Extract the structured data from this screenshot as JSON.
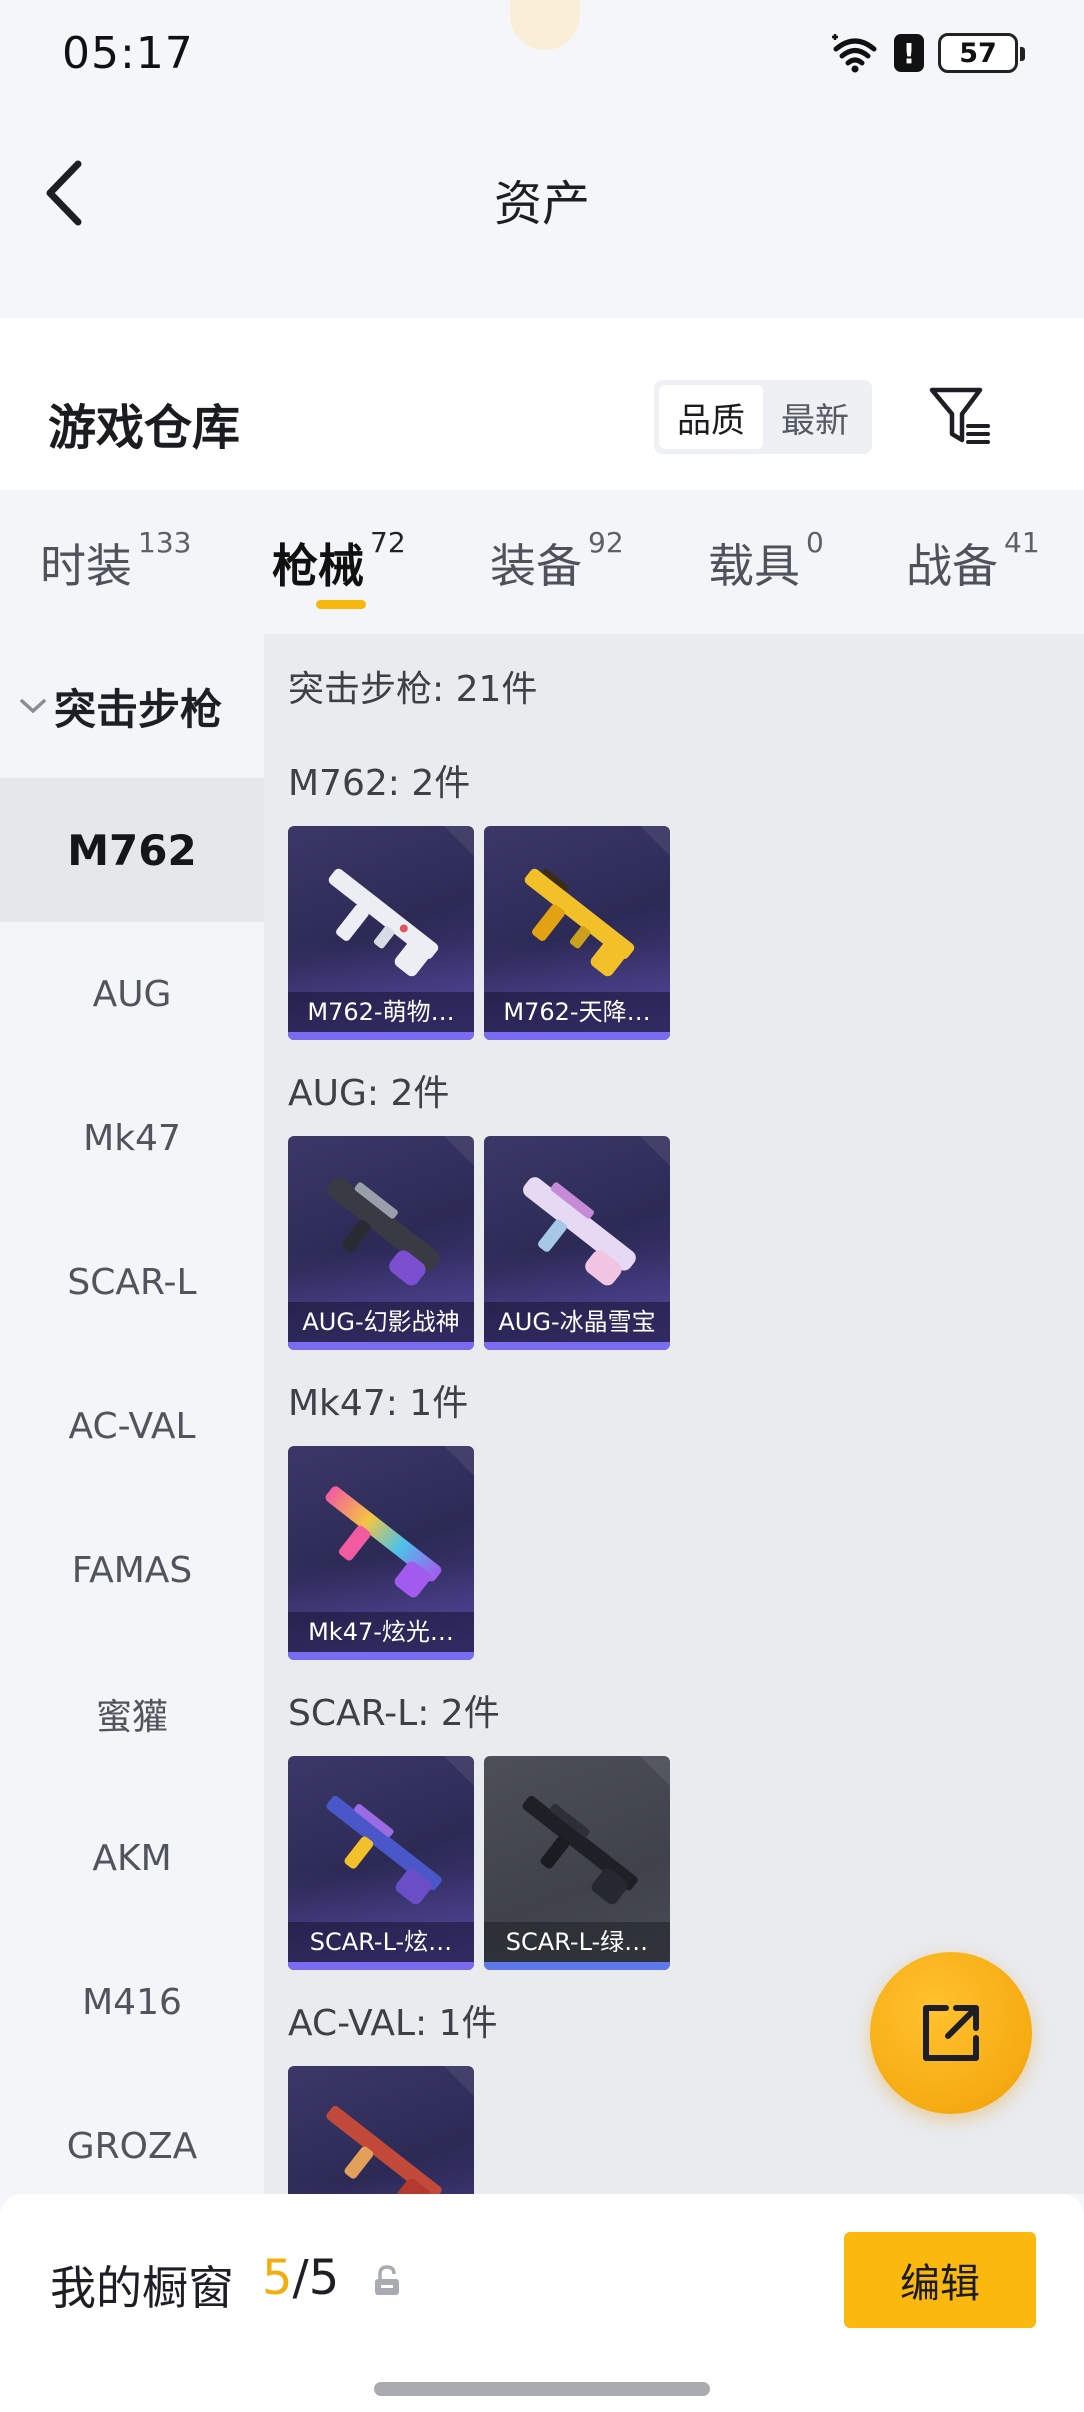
{
  "status_bar": {
    "time": "05:17",
    "battery": "57",
    "alert_glyph": "!"
  },
  "header": {
    "title": "资产"
  },
  "warehouse": {
    "title": "游戏仓库",
    "sort_options": [
      "品质",
      "最新"
    ],
    "sort_selected": "品质"
  },
  "tabs": [
    {
      "label": "时装",
      "count": "133"
    },
    {
      "label": "枪械",
      "count": "72"
    },
    {
      "label": "装备",
      "count": "92"
    },
    {
      "label": "载具",
      "count": "0"
    },
    {
      "label": "战备",
      "count": "41"
    }
  ],
  "active_tab": "枪械",
  "sidebar": {
    "category": "突击步枪",
    "items": [
      "M762",
      "AUG",
      "Mk47",
      "SCAR-L",
      "AC-VAL",
      "FAMAS",
      "蜜獾",
      "AKM",
      "M416",
      "GROZA"
    ],
    "active_item": "M762"
  },
  "main": {
    "header": "突击步枪: 21件",
    "groups": [
      {
        "label": "M762: 2件",
        "items": [
          {
            "name": "M762-萌物…",
            "style": "purple",
            "icon": "rifle-white-icon"
          },
          {
            "name": "M762-天降…",
            "style": "purple",
            "icon": "rifle-gold-icon"
          }
        ]
      },
      {
        "label": "AUG: 2件",
        "items": [
          {
            "name": "AUG-幻影战神",
            "style": "purple",
            "icon": "rifle-dark-icon"
          },
          {
            "name": "AUG-冰晶雪宝",
            "style": "purple",
            "icon": "rifle-pink-icon"
          }
        ]
      },
      {
        "label": "Mk47: 1件",
        "items": [
          {
            "name": "Mk47-炫光…",
            "style": "purple",
            "icon": "rifle-rainbow-icon"
          }
        ]
      },
      {
        "label": "SCAR-L: 2件",
        "items": [
          {
            "name": "SCAR-L-炫…",
            "style": "purple",
            "icon": "rifle-blue-icon"
          },
          {
            "name": "SCAR-L-绿…",
            "style": "grey",
            "icon": "rifle-black-icon"
          }
        ]
      },
      {
        "label": "AC-VAL: 1件",
        "items": [
          {
            "name": "",
            "style": "purple",
            "icon": "rifle-red-icon"
          }
        ]
      }
    ]
  },
  "showcase": {
    "title": "我的橱窗",
    "current": "5",
    "separator": "/",
    "total": "5",
    "edit_label": "编辑"
  },
  "colors": {
    "accent": "#f8b70d",
    "card_purple": "#2c2a55",
    "card_grey": "#43464e"
  }
}
